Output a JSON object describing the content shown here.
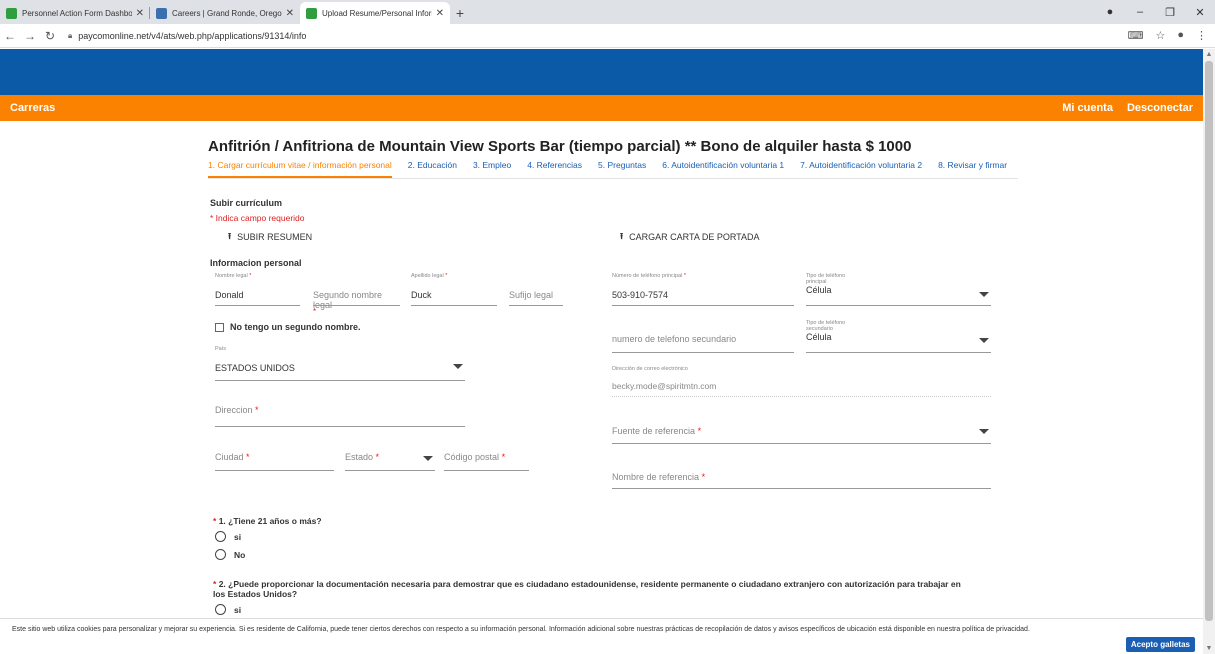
{
  "browser": {
    "tabs": [
      {
        "title": "Personnel Action Form Dashboar",
        "color": "#2e9e3e",
        "active": false
      },
      {
        "title": "Careers | Grand Ronde, Oregon |",
        "color": "#3c6fb0",
        "active": false
      },
      {
        "title": "Upload Resume/Personal Inform",
        "color": "#2e9e3e",
        "active": true
      }
    ],
    "new_tab": "+",
    "url": "paycomonline.net/v4/ats/web.php/applications/91314/info"
  },
  "header": {
    "brand": "Carreras",
    "my_account": "Mi cuenta",
    "logout": "Desconectar"
  },
  "job_title": "Anfitrión / Anfitriona de Mountain View Sports Bar (tiempo parcial) ** Bono de alquiler hasta $ 1000",
  "steps": [
    "1. Cargar currículum vitae / información personal",
    "2. Educación",
    "3. Empleo",
    "4. Referencias",
    "5. Preguntas",
    "6. Autoidentificación voluntaria 1",
    "7. Autoidentificación voluntaria 2",
    "8. Revisar y firmar"
  ],
  "upload": {
    "section": "Subir currículum",
    "required_note": "* Indica campo requerido",
    "resume_btn": "SUBIR RESUMEN",
    "cover_btn": "CARGAR CARTA DE PORTADA"
  },
  "personal": {
    "section": "Informacion personal",
    "first_name_label": "Nombre legal",
    "first_name": "Donald",
    "middle_name_ph": "Segundo nombre legal",
    "last_name_label": "Apellido legal",
    "last_name": "Duck",
    "suffix_ph": "Sufijo legal",
    "no_middle": "No tengo un segundo nombre.",
    "country_label": "País",
    "country": "ESTADOS UNIDOS",
    "address_ph": "Direccion",
    "city_ph": "Ciudad",
    "state_ph": "Estado",
    "zip_ph": "Código postal",
    "phone_label": "Número de teléfono principal",
    "phone": "503-910-7574",
    "phone_type_label": "Tipo de teléfono principal",
    "phone_type": "Célula",
    "phone2_ph": "numero de telefono secundario",
    "phone2_type_label": "Tipo de teléfono secundario",
    "phone2_type": "Célula",
    "email_label": "Dirección de correo electrónico",
    "email": "becky.mode@spiritmtn.com",
    "referral_source_ph": "Fuente de referencia",
    "referral_name_ph": "Nombre de referencia"
  },
  "questions": [
    {
      "number": "1.",
      "text": "¿Tiene 21 años o más?",
      "options": [
        "si",
        "No"
      ]
    },
    {
      "number": "2.",
      "text": "¿Puede proporcionar la documentación necesaria para demostrar que es ciudadano estadounidense, residente permanente o ciudadano extranjero con autorización para trabajar en los Estados Unidos?",
      "options": [
        "si"
      ]
    }
  ],
  "cookie": {
    "text": "Este sitio web utiliza cookies para personalizar y mejorar su experiencia. Si es residente de California, puede tener ciertos derechos con respecto a su información personal. Información adicional sobre nuestras prácticas de recopilación de datos y avisos específicos de ubicación está disponible en nuestra política de privacidad.",
    "accept": "Acepto galletas"
  },
  "colors": {
    "blue": "#0a5aa8",
    "orange": "#fb8200",
    "link": "#1a5fb4",
    "required": "#e02020"
  }
}
